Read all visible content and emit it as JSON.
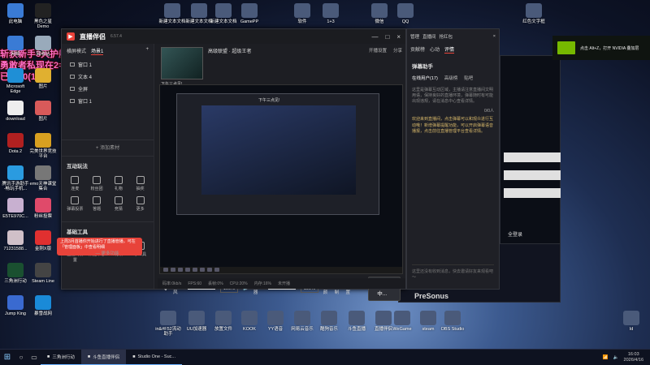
{
  "overlay": {
    "line1": "斩获新手3天护航期",
    "line2": "勇敢者私现在2=1",
    "line3": "已投10(1)"
  },
  "desktop_icons_left": [
    {
      "name": "此电脑",
      "icon": "pc-icon",
      "color": "#3a7bd5"
    },
    {
      "name": "黑色之星 Demo",
      "icon": "game-icon",
      "color": "#222"
    },
    {
      "name": "网络",
      "icon": "network-icon",
      "color": "#3a7bd5"
    },
    {
      "name": "回收站",
      "icon": "recycle-icon",
      "color": "#9ab"
    },
    {
      "name": "Microsoft Edge",
      "icon": "edge-icon",
      "color": "#1f8fd6"
    },
    {
      "name": "图片",
      "icon": "photo-icon",
      "color": "#e0b030"
    },
    {
      "name": "download",
      "icon": "folder-icon",
      "color": "#eee"
    },
    {
      "name": "图片",
      "icon": "photo-icon",
      "color": "#d85a5a"
    },
    {
      "name": "Dota 2",
      "icon": "dota-icon",
      "color": "#b02020"
    },
    {
      "name": "完美世界竞技平台",
      "icon": "esports-icon",
      "color": "#d8a020"
    },
    {
      "name": "腾讯手游助手 -畅玩手机...",
      "icon": "tencent-icon",
      "color": "#2a9be0"
    },
    {
      "name": "emo天神课堂集合",
      "icon": "folder-icon",
      "color": "#777"
    },
    {
      "name": "E5TE970C...",
      "icon": "image-icon",
      "color": "#c8b0d0"
    },
    {
      "name": "粉丝投票",
      "icon": "vote-icon",
      "color": "#e04a6a"
    },
    {
      "name": "71231588...",
      "icon": "image-icon",
      "color": "#d0c0c8"
    },
    {
      "name": "金刚X版",
      "icon": "app-icon",
      "color": "#e03030"
    },
    {
      "name": "三角洲行动",
      "icon": "delta-icon",
      "color": "#1a5030"
    },
    {
      "name": "Steam Line",
      "icon": "steam-icon",
      "color": "#444"
    },
    {
      "name": "Jump King",
      "icon": "jumpking-icon",
      "color": "#3a6ad0"
    },
    {
      "name": "暴雪战网",
      "icon": "battlenet-icon",
      "color": "#1a8ad8"
    }
  ],
  "desktop_icons_top": [
    {
      "name": "新建文本文档",
      "icon": "doc-icon"
    },
    {
      "name": "新建文本文档",
      "icon": "doc-icon"
    },
    {
      "name": "新建文本文档",
      "icon": "doc-icon"
    },
    {
      "name": "GamePP",
      "icon": "gpp-icon"
    },
    {
      "name": "软件",
      "icon": "folder-icon"
    },
    {
      "name": "1+3",
      "icon": "doc-icon"
    },
    {
      "name": "微信",
      "icon": "wechat-icon"
    },
    {
      "name": "QQ",
      "icon": "qq-icon"
    },
    {
      "name": "红色文字框",
      "icon": "doc-icon"
    }
  ],
  "desktop_icons_bottom": [
    {
      "name": "in&#F52流动助手",
      "icon": "app-icon"
    },
    {
      "name": "UU加速器",
      "icon": "uu-icon"
    },
    {
      "name": "放置文件",
      "icon": "folder-icon"
    },
    {
      "name": "KOOK",
      "icon": "kook-icon"
    },
    {
      "name": "YY语音",
      "icon": "yy-icon"
    },
    {
      "name": "网易云音乐",
      "icon": "music-icon"
    },
    {
      "name": "酷狗音乐",
      "icon": "kugou-icon"
    },
    {
      "name": "斗鱼直播",
      "icon": "douyu-icon"
    },
    {
      "name": "直播伴侣",
      "icon": "live-icon"
    },
    {
      "name": "WeGame",
      "icon": "wegame-icon"
    },
    {
      "name": "steam",
      "icon": "steam-icon"
    },
    {
      "name": "OBS Studio",
      "icon": "obs-icon"
    },
    {
      "name": "Id",
      "icon": "app-icon"
    }
  ],
  "app": {
    "name": "直播伴侣",
    "version": "6.57.4",
    "mode": "横屏模式",
    "scenes": [
      "场景1"
    ],
    "sources": [
      "窗口 1",
      "文本 4",
      "全屏",
      "窗口 1"
    ],
    "add_source": "+ 添加素材",
    "tools_title": "互动玩法",
    "tools": [
      "连麦",
      "粉丝团",
      "礼物",
      "抽奖",
      "弹幕投票",
      "答题",
      "竞猜",
      "更多"
    ],
    "basic_title": "基础工具",
    "basic_tools": [
      "直播间设置",
      "数据中心",
      "特效",
      "小工具"
    ],
    "more_functions": "— 更多功能",
    "toast": "上周3月首播你开始进行了直播管播，可在「管理面板」中查看明细",
    "thumb_caption": "下午三点见!",
    "thumb_tag": "高级联盟 · 超级王者",
    "strip_right": [
      "开播设置",
      "分享"
    ],
    "preview_label": "下午三点见!",
    "mic_label": "麦克风",
    "mic_value": "100%",
    "speaker_label": "扬声器",
    "speaker_value": "100%",
    "extras": [
      "美颜",
      "录制",
      "设置"
    ],
    "go_live": "连接中...",
    "status": [
      "码率:0kb/s",
      "FPS:60",
      "丢帧:0%",
      "CPU:20%",
      "内存:16%",
      "未开播"
    ]
  },
  "danmaku": {
    "head": [
      "管理",
      "直播间",
      "抢红包"
    ],
    "tabs": [
      "贡献榜",
      "心动",
      "评情"
    ],
    "title": "弹幕助手",
    "sub_tabs": [
      "在线用户(17)",
      "高级榜",
      "贴吧"
    ],
    "note": "这里是弹幕互动区域，主播请注意直播间文明用语，保持良好的直播环境，弹幕随时有可能出现违规，请在消息中心查看详情。",
    "count": "0/0人",
    "notice": "欢迎来到直播间，点击弹幕可以和观众进行互动哦！新增弹幕提醒功能，可以开启弹幕语音播报，点击前往直播管理平台查看详情。",
    "input": "这里还没有收到消息，快去邀请好友来观看吧～"
  },
  "nvidia": {
    "text": "点击 Alt+Z，打开 NVIDIA 叠加层"
  },
  "bg_app": {
    "brand": "PreSonus",
    "login": "全登录"
  },
  "taskbar": {
    "apps": [
      {
        "label": "三角洲行动",
        "active": false
      },
      {
        "label": "斗鱼直播伴侣",
        "active": true
      },
      {
        "label": "Studio One - Suc...",
        "active": false
      }
    ],
    "time": "16:03",
    "date": "2026/4/16"
  }
}
